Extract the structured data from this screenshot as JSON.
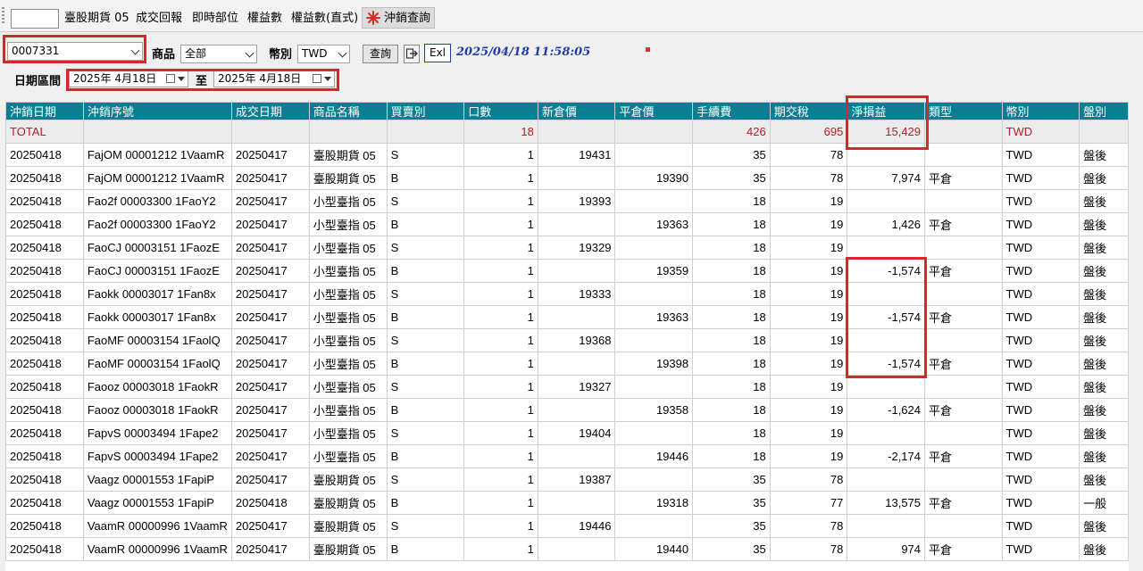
{
  "tabs": [
    {
      "label": "臺股期貨 05"
    },
    {
      "label": "成交回報"
    },
    {
      "label": "即時部位"
    },
    {
      "label": "權益數"
    },
    {
      "label": "權益數(直式)"
    },
    {
      "label": "沖銷查詢",
      "active": true
    }
  ],
  "toolbar": {
    "account_value": "0007331",
    "product_label": "商品",
    "product_value": "全部",
    "currency_label": "幣別",
    "currency_value": "TWD",
    "query_label": "查詢",
    "excel_label": "Exl",
    "datetime": "2025/04/18 11:58:05",
    "date_range_label": "日期區間",
    "date_from": "2025年  4月18日",
    "date_to_label": "至",
    "date_to": "2025年  4月18日"
  },
  "table": {
    "columns": [
      "沖銷日期",
      "沖銷序號",
      "成交日期",
      "商品名稱",
      "買賣別",
      "口數",
      "新倉價",
      "平倉價",
      "手續費",
      "期交稅",
      "淨損益",
      "類型",
      "幣別",
      "盤別"
    ],
    "total": [
      "TOTAL",
      "",
      "",
      "",
      "",
      "18",
      "",
      "",
      "426",
      "695",
      "15,429",
      "",
      "TWD",
      ""
    ],
    "rows": [
      [
        "20250418",
        "FajOM 00001212  1VaamR",
        "20250417",
        "臺股期貨 05",
        "S",
        "1",
        "19431",
        "",
        "35",
        "78",
        "",
        "",
        "TWD",
        "盤後"
      ],
      [
        "20250418",
        "FajOM 00001212  1VaamR",
        "20250417",
        "臺股期貨 05",
        "B",
        "1",
        "",
        "19390",
        "35",
        "78",
        "7,974",
        "平倉",
        "TWD",
        "盤後"
      ],
      [
        "20250418",
        "Fao2f 00003300  1FaoY2",
        "20250417",
        "小型臺指 05",
        "S",
        "1",
        "19393",
        "",
        "18",
        "19",
        "",
        "",
        "TWD",
        "盤後"
      ],
      [
        "20250418",
        "Fao2f 00003300  1FaoY2",
        "20250417",
        "小型臺指 05",
        "B",
        "1",
        "",
        "19363",
        "18",
        "19",
        "1,426",
        "平倉",
        "TWD",
        "盤後"
      ],
      [
        "20250418",
        "FaoCJ 00003151  1FaozE",
        "20250417",
        "小型臺指 05",
        "S",
        "1",
        "19329",
        "",
        "18",
        "19",
        "",
        "",
        "TWD",
        "盤後"
      ],
      [
        "20250418",
        "FaoCJ 00003151  1FaozE",
        "20250417",
        "小型臺指 05",
        "B",
        "1",
        "",
        "19359",
        "18",
        "19",
        "-1,574",
        "平倉",
        "TWD",
        "盤後"
      ],
      [
        "20250418",
        "Faokk 00003017  1Fan8x",
        "20250417",
        "小型臺指 05",
        "S",
        "1",
        "19333",
        "",
        "18",
        "19",
        "",
        "",
        "TWD",
        "盤後"
      ],
      [
        "20250418",
        "Faokk 00003017  1Fan8x",
        "20250417",
        "小型臺指 05",
        "B",
        "1",
        "",
        "19363",
        "18",
        "19",
        "-1,574",
        "平倉",
        "TWD",
        "盤後"
      ],
      [
        "20250418",
        "FaoMF 00003154  1FaolQ",
        "20250417",
        "小型臺指 05",
        "S",
        "1",
        "19368",
        "",
        "18",
        "19",
        "",
        "",
        "TWD",
        "盤後"
      ],
      [
        "20250418",
        "FaoMF 00003154  1FaolQ",
        "20250417",
        "小型臺指 05",
        "B",
        "1",
        "",
        "19398",
        "18",
        "19",
        "-1,574",
        "平倉",
        "TWD",
        "盤後"
      ],
      [
        "20250418",
        "Faooz 00003018  1FaokR",
        "20250417",
        "小型臺指 05",
        "S",
        "1",
        "19327",
        "",
        "18",
        "19",
        "",
        "",
        "TWD",
        "盤後"
      ],
      [
        "20250418",
        "Faooz 00003018  1FaokR",
        "20250417",
        "小型臺指 05",
        "B",
        "1",
        "",
        "19358",
        "18",
        "19",
        "-1,624",
        "平倉",
        "TWD",
        "盤後"
      ],
      [
        "20250418",
        "FapvS 00003494  1Fape2",
        "20250417",
        "小型臺指 05",
        "S",
        "1",
        "19404",
        "",
        "18",
        "19",
        "",
        "",
        "TWD",
        "盤後"
      ],
      [
        "20250418",
        "FapvS 00003494  1Fape2",
        "20250417",
        "小型臺指 05",
        "B",
        "1",
        "",
        "19446",
        "18",
        "19",
        "-2,174",
        "平倉",
        "TWD",
        "盤後"
      ],
      [
        "20250418",
        "Vaagz 00001553  1FapiP",
        "20250417",
        "臺股期貨 05",
        "S",
        "1",
        "19387",
        "",
        "35",
        "78",
        "",
        "",
        "TWD",
        "盤後"
      ],
      [
        "20250418",
        "Vaagz 00001553  1FapiP",
        "20250418",
        "臺股期貨 05",
        "B",
        "1",
        "",
        "19318",
        "35",
        "77",
        "13,575",
        "平倉",
        "TWD",
        "一般"
      ],
      [
        "20250418",
        "VaamR 00000996  1VaamR",
        "20250417",
        "臺股期貨 05",
        "S",
        "1",
        "19446",
        "",
        "35",
        "78",
        "",
        "",
        "TWD",
        "盤後"
      ],
      [
        "20250418",
        "VaamR 00000996  1VaamR",
        "20250417",
        "臺股期貨 05",
        "B",
        "1",
        "",
        "19440",
        "35",
        "78",
        "974",
        "平倉",
        "TWD",
        "盤後"
      ]
    ]
  },
  "colors": {
    "header_bg": "#0a7e92",
    "total_text": "#b3202a",
    "highlight": "#d9262c",
    "datetime": "#1f3da8"
  }
}
